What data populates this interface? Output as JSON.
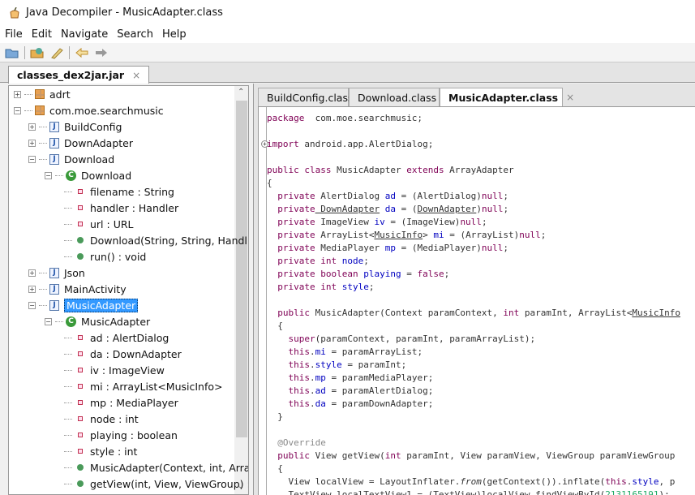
{
  "window": {
    "title": "Java Decompiler - MusicAdapter.class"
  },
  "menu": [
    {
      "label": "File"
    },
    {
      "label": "Edit"
    },
    {
      "label": "Navigate"
    },
    {
      "label": "Search"
    },
    {
      "label": "Help"
    }
  ],
  "toolbar": [
    "open-file-icon",
    "open-type-icon",
    "search-icon",
    "back-arrow-icon",
    "forward-arrow-icon"
  ],
  "jar_tab": {
    "label": "classes_dex2jar.jar",
    "close": "×"
  },
  "tree": [
    {
      "label": "adrt",
      "kind": "package",
      "level": 0,
      "expander": "+"
    },
    {
      "label": "com.moe.searchmusic",
      "kind": "package",
      "level": 0,
      "expander": "-"
    },
    {
      "label": "BuildConfig",
      "kind": "file",
      "level": 1,
      "expander": "+"
    },
    {
      "label": "DownAdapter",
      "kind": "file",
      "level": 1,
      "expander": "+"
    },
    {
      "label": "Download",
      "kind": "file",
      "level": 1,
      "expander": "-"
    },
    {
      "label": "Download",
      "kind": "class",
      "level": 2,
      "expander": "-"
    },
    {
      "label": "filename : String",
      "kind": "field",
      "level": 3
    },
    {
      "label": "handler : Handler",
      "kind": "field",
      "level": 3
    },
    {
      "label": "url : URL",
      "kind": "field",
      "level": 3
    },
    {
      "label": "Download(String, String, Handl",
      "kind": "method",
      "level": 3
    },
    {
      "label": "run() : void",
      "kind": "method",
      "level": 3
    },
    {
      "label": "Json",
      "kind": "file",
      "level": 1,
      "expander": "+"
    },
    {
      "label": "MainActivity",
      "kind": "file",
      "level": 1,
      "expander": "+"
    },
    {
      "label": "MusicAdapter",
      "kind": "file",
      "level": 1,
      "expander": "-",
      "selected": true
    },
    {
      "label": "MusicAdapter",
      "kind": "class",
      "level": 2,
      "expander": "-"
    },
    {
      "label": "ad : AlertDialog",
      "kind": "field",
      "level": 3
    },
    {
      "label": "da : DownAdapter",
      "kind": "field",
      "level": 3
    },
    {
      "label": "iv : ImageView",
      "kind": "field",
      "level": 3
    },
    {
      "label": "mi : ArrayList<MusicInfo>",
      "kind": "field",
      "level": 3
    },
    {
      "label": "mp : MediaPlayer",
      "kind": "field",
      "level": 3
    },
    {
      "label": "node : int",
      "kind": "field",
      "level": 3
    },
    {
      "label": "playing : boolean",
      "kind": "field",
      "level": 3
    },
    {
      "label": "style : int",
      "kind": "field",
      "level": 3
    },
    {
      "label": "MusicAdapter(Context, int, Arra",
      "kind": "method",
      "level": 3
    },
    {
      "label": "getView(int, View, ViewGroup) :",
      "kind": "method",
      "level": 3
    }
  ],
  "editor_tabs": [
    {
      "label": "BuildConfig.class"
    },
    {
      "label": "Download.class"
    },
    {
      "label": "MusicAdapter.class",
      "active": true,
      "close": "×"
    }
  ],
  "code": [
    [
      [
        "kw",
        "package"
      ],
      [
        "",
        "  com.moe.searchmusic;"
      ]
    ],
    [],
    [
      [
        "kw",
        "import"
      ],
      [
        "",
        " android.app.AlertDialog;"
      ]
    ],
    [],
    [
      [
        "kw",
        "public class"
      ],
      [
        "",
        " MusicAdapter "
      ],
      [
        "kw",
        "extends"
      ],
      [
        "",
        " ArrayAdapter"
      ]
    ],
    [
      [
        "",
        "{"
      ]
    ],
    [
      [
        "",
        "  "
      ],
      [
        "kw",
        "private"
      ],
      [
        "",
        " AlertDialog "
      ],
      [
        "fd",
        "ad"
      ],
      [
        "",
        " = (AlertDialog)"
      ],
      [
        "kw",
        "null"
      ],
      [
        "",
        ";"
      ]
    ],
    [
      [
        "",
        "  "
      ],
      [
        "kw",
        "private"
      ],
      [
        "",
        ""
      ],
      [
        "ul",
        " DownAdapter"
      ],
      [
        "",
        " "
      ],
      [
        "fd",
        "da"
      ],
      [
        "",
        " = ("
      ],
      [
        "ul",
        "DownAdapter"
      ],
      [
        "",
        ")"
      ],
      [
        "kw",
        "null"
      ],
      [
        "",
        ";"
      ]
    ],
    [
      [
        "",
        "  "
      ],
      [
        "kw",
        "private"
      ],
      [
        "",
        " ImageView "
      ],
      [
        "fd",
        "iv"
      ],
      [
        "",
        " = (ImageView)"
      ],
      [
        "kw",
        "null"
      ],
      [
        "",
        ";"
      ]
    ],
    [
      [
        "",
        "  "
      ],
      [
        "kw",
        "private"
      ],
      [
        "",
        " ArrayList<"
      ],
      [
        "ul",
        "MusicInfo"
      ],
      [
        "",
        "> "
      ],
      [
        "fd",
        "mi"
      ],
      [
        "",
        " = (ArrayList)"
      ],
      [
        "kw",
        "null"
      ],
      [
        "",
        ";"
      ]
    ],
    [
      [
        "",
        "  "
      ],
      [
        "kw",
        "private"
      ],
      [
        "",
        " MediaPlayer "
      ],
      [
        "fd",
        "mp"
      ],
      [
        "",
        " = (MediaPlayer)"
      ],
      [
        "kw",
        "null"
      ],
      [
        "",
        ";"
      ]
    ],
    [
      [
        "",
        "  "
      ],
      [
        "kw",
        "private int"
      ],
      [
        "",
        " "
      ],
      [
        "fd",
        "node"
      ],
      [
        "",
        ";"
      ]
    ],
    [
      [
        "",
        "  "
      ],
      [
        "kw",
        "private boolean"
      ],
      [
        "",
        " "
      ],
      [
        "fd",
        "playing"
      ],
      [
        "",
        " = "
      ],
      [
        "kw",
        "false"
      ],
      [
        "",
        ";"
      ]
    ],
    [
      [
        "",
        "  "
      ],
      [
        "kw",
        "private int"
      ],
      [
        "",
        " "
      ],
      [
        "fd",
        "style"
      ],
      [
        "",
        ";"
      ]
    ],
    [],
    [
      [
        "",
        "  "
      ],
      [
        "kw",
        "public"
      ],
      [
        "",
        " MusicAdapter(Context paramContext, "
      ],
      [
        "kw",
        "int"
      ],
      [
        "",
        " paramInt, ArrayList<"
      ],
      [
        "ul",
        "MusicInfo"
      ]
    ],
    [
      [
        "",
        "  {"
      ]
    ],
    [
      [
        "",
        "    "
      ],
      [
        "kw",
        "super"
      ],
      [
        "",
        "(paramContext, paramInt, paramArrayList);"
      ]
    ],
    [
      [
        "",
        "    "
      ],
      [
        "kw",
        "this"
      ],
      [
        "",
        "."
      ],
      [
        "fd",
        "mi"
      ],
      [
        "",
        " = paramArrayList;"
      ]
    ],
    [
      [
        "",
        "    "
      ],
      [
        "kw",
        "this"
      ],
      [
        "",
        "."
      ],
      [
        "fd",
        "style"
      ],
      [
        "",
        " = paramInt;"
      ]
    ],
    [
      [
        "",
        "    "
      ],
      [
        "kw",
        "this"
      ],
      [
        "",
        "."
      ],
      [
        "fd",
        "mp"
      ],
      [
        "",
        " = paramMediaPlayer;"
      ]
    ],
    [
      [
        "",
        "    "
      ],
      [
        "kw",
        "this"
      ],
      [
        "",
        "."
      ],
      [
        "fd",
        "ad"
      ],
      [
        "",
        " = paramAlertDialog;"
      ]
    ],
    [
      [
        "",
        "    "
      ],
      [
        "kw",
        "this"
      ],
      [
        "",
        "."
      ],
      [
        "fd",
        "da"
      ],
      [
        "",
        " = paramDownAdapter;"
      ]
    ],
    [
      [
        "",
        "  }"
      ]
    ],
    [],
    [
      [
        "",
        "  "
      ],
      [
        "an",
        "@Override"
      ]
    ],
    [
      [
        "",
        "  "
      ],
      [
        "kw",
        "public"
      ],
      [
        "",
        " View getView("
      ],
      [
        "kw",
        "int"
      ],
      [
        "",
        " paramInt, View paramView, ViewGroup paramViewGroup"
      ]
    ],
    [
      [
        "",
        "  {"
      ]
    ],
    [
      [
        "",
        "    View localView = LayoutInflater."
      ],
      [
        "it",
        "from"
      ],
      [
        "",
        "(getContext()).inflate("
      ],
      [
        "kw",
        "this"
      ],
      [
        "",
        "."
      ],
      [
        "fd",
        "style"
      ],
      [
        "",
        ", p"
      ]
    ],
    [
      [
        "",
        "    TextView localTextView1 = (TextView)localView.findViewById("
      ],
      [
        "nm",
        "2131165191"
      ],
      [
        "",
        ");"
      ]
    ]
  ],
  "colors": {
    "keyword": "#7f0055",
    "field": "#0000c0",
    "selection": "#3399ff"
  }
}
